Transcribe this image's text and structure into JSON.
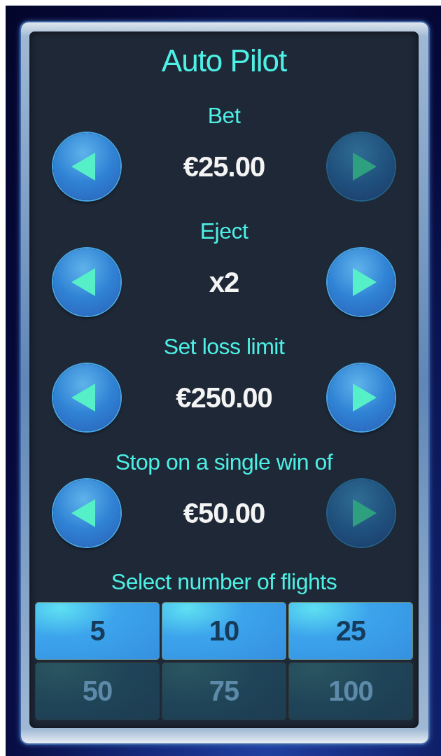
{
  "title": "Auto Pilot",
  "settings": [
    {
      "label": "Bet",
      "value": "€25.00",
      "decrease_disabled": false,
      "increase_disabled": true
    },
    {
      "label": "Eject",
      "value": "x2",
      "decrease_disabled": false,
      "increase_disabled": false
    },
    {
      "label": "Set loss limit",
      "value": "€250.00",
      "decrease_disabled": false,
      "increase_disabled": false
    },
    {
      "label": "Stop on a single win of",
      "value": "€50.00",
      "decrease_disabled": false,
      "increase_disabled": true
    }
  ],
  "flights": {
    "label": "Select number of flights",
    "options": [
      {
        "label": "5",
        "disabled": false
      },
      {
        "label": "10",
        "disabled": false
      },
      {
        "label": "25",
        "disabled": false
      },
      {
        "label": "50",
        "disabled": true
      },
      {
        "label": "75",
        "disabled": true
      },
      {
        "label": "100",
        "disabled": true
      }
    ]
  }
}
